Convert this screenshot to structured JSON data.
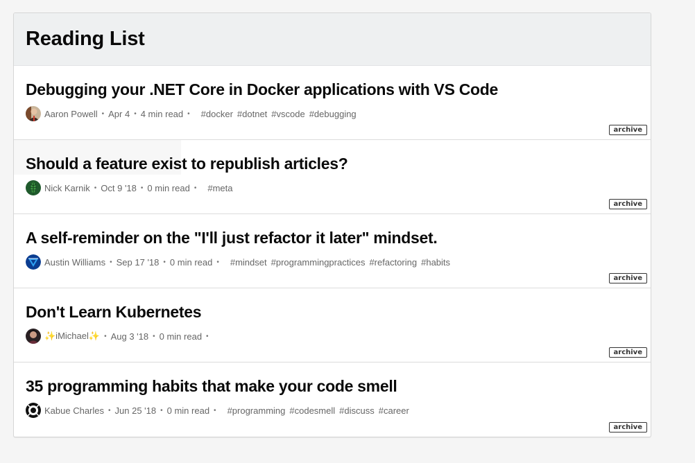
{
  "header": {
    "title": "Reading List"
  },
  "archive_label": "archive",
  "items": [
    {
      "title": "Debugging your .NET Core in Docker applications with VS Code",
      "author": "Aaron Powell",
      "date": "Apr 4",
      "read_time": "4 min read",
      "tags": [
        "#docker",
        "#dotnet",
        "#vscode",
        "#debugging"
      ],
      "avatar_icon": "person-photo-avatar"
    },
    {
      "title": "Should a feature exist to republish articles?",
      "author": "Nick Karnik",
      "date": "Oct 9 '18",
      "read_time": "0 min read",
      "tags": [
        "#meta"
      ],
      "avatar_icon": "leaf-avatar"
    },
    {
      "title": "A self-reminder on the \"I'll just refactor it later\" mindset.",
      "author": "Austin Williams",
      "date": "Sep 17 '18",
      "read_time": "0 min read",
      "tags": [
        "#mindset",
        "#programmingpractices",
        "#refactoring",
        "#habits"
      ],
      "avatar_icon": "blue-triangle-logo-avatar"
    },
    {
      "title": "Don't Learn Kubernetes",
      "author": "✨iMichael✨",
      "date": "Aug 3 '18",
      "read_time": "0 min read",
      "tags": [],
      "avatar_icon": "person-photo-avatar"
    },
    {
      "title": "35 programming habits that make your code smell",
      "author": "Kabue Charles",
      "date": "Jun 25 '18",
      "read_time": "0 min read",
      "tags": [
        "#programming",
        "#codesmell",
        "#discuss",
        "#career"
      ],
      "avatar_icon": "bw-pattern-avatar"
    }
  ]
}
